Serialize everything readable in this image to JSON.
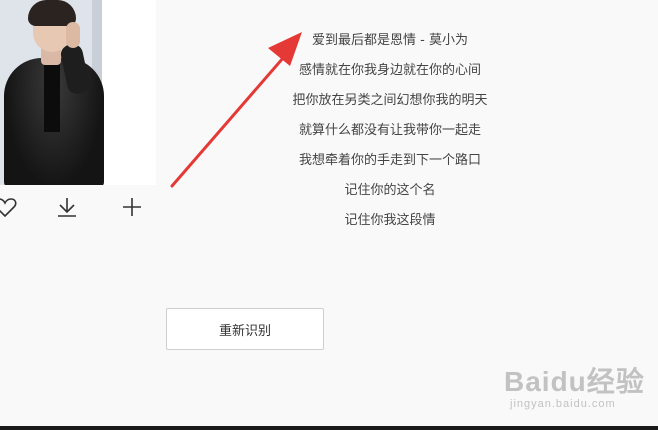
{
  "album": {
    "cover_alt": "album cover"
  },
  "actions": {
    "like_icon": "heart-icon",
    "download_icon": "download-icon",
    "add_icon": "plus-icon"
  },
  "lyrics": {
    "lines": [
      "爱到最后都是恩情 - 莫小为",
      "感情就在你我身边就在你的心间",
      "把你放在另类之间幻想你我的明天",
      "就算什么都没有让我带你一起走",
      "我想牵着你的手走到下一个路口",
      "记住你的这个名",
      "记住你我这段情"
    ]
  },
  "reidentify_button": {
    "label": "重新识别"
  },
  "annotation": {
    "arrow_color": "#e53935"
  },
  "watermark": {
    "brand": "Baidu经验",
    "url": "jingyan.baidu.com"
  }
}
